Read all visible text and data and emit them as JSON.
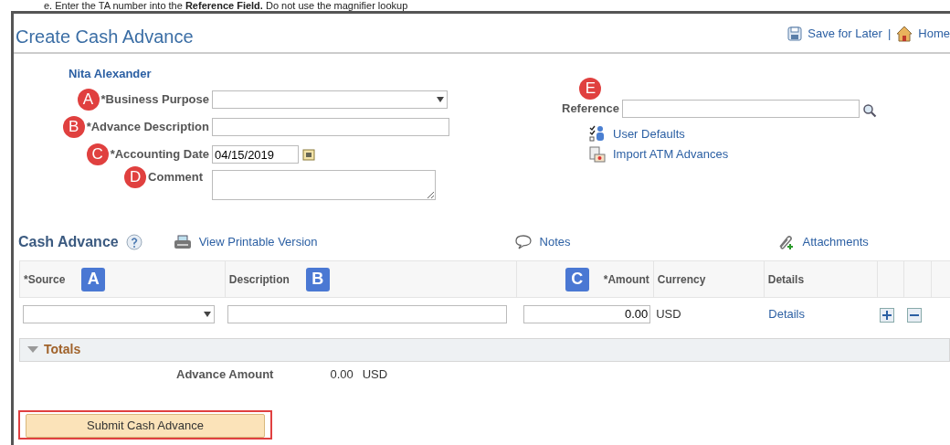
{
  "instruction": {
    "step": "e.",
    "text": "Enter the TA number into the **Reference Field.** Do not use the magnifier lookup"
  },
  "page_title": "Create Cash Advance",
  "header_links": [
    {
      "kind": "save",
      "label": "Save for Later"
    },
    {
      "kind": "separator",
      "label": "|"
    },
    {
      "kind": "home",
      "label": "Home"
    }
  ],
  "employee_name": "Nita Alexander",
  "form_fields": [
    {
      "kind": "select",
      "label": "*Business Purpose",
      "marker": "A"
    },
    {
      "kind": "text",
      "label": "*Advance Description",
      "marker": "B"
    },
    {
      "kind": "date",
      "label": "*Accounting Date",
      "marker": "C",
      "value": "04/15/2019"
    },
    {
      "kind": "textarea",
      "label": "Comment",
      "marker": "D"
    }
  ],
  "reference": {
    "label": "Reference",
    "marker": "E"
  },
  "side_links": [
    {
      "kind": "defaults",
      "label": "User Defaults"
    },
    {
      "kind": "import",
      "label": "Import ATM Advances"
    }
  ],
  "section": {
    "title": "Cash Advance",
    "toolbar": [
      {
        "kind": "print",
        "label": "View Printable Version"
      },
      {
        "kind": "notes",
        "label": "Notes"
      },
      {
        "kind": "attach",
        "label": "Attachments"
      }
    ]
  },
  "table": {
    "columns": [
      {
        "label": "*Source",
        "marker": "A"
      },
      {
        "label": "Description",
        "marker": "B"
      },
      {
        "label": "*Amount",
        "marker": "C"
      },
      {
        "label": "Currency"
      },
      {
        "label": "Details"
      }
    ],
    "rows": [
      {
        "amount": "0.00",
        "currency": "USD",
        "details": "Details"
      }
    ]
  },
  "totals": {
    "title": "Totals",
    "expanded": true,
    "label": "Advance Amount",
    "value": "0.00",
    "currency": "USD"
  },
  "submit_button": {
    "label": "Submit Cash Advance",
    "highlighted": true
  }
}
